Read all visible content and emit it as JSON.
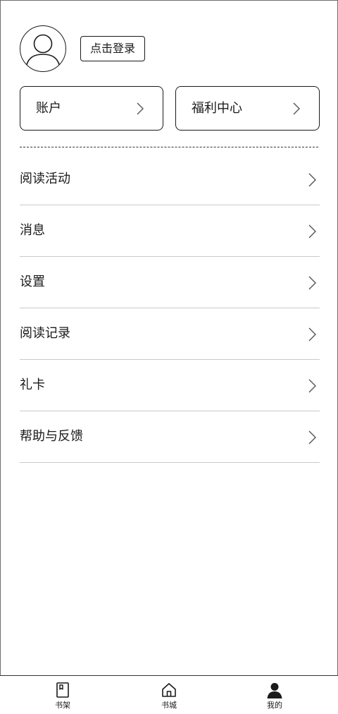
{
  "header": {
    "avatar_icon": "user-avatar-icon",
    "login_label": "点击登录"
  },
  "cards": {
    "account": {
      "label": "账户",
      "icon": "chevron-right-icon"
    },
    "welfare": {
      "label": "福利中心",
      "icon": "chevron-right-icon"
    }
  },
  "menu": {
    "items": [
      {
        "label": "阅读活动"
      },
      {
        "label": "消息"
      },
      {
        "label": "设置"
      },
      {
        "label": "阅读记录"
      },
      {
        "label": "礼卡"
      },
      {
        "label": "帮助与反馈"
      }
    ]
  },
  "tabbar": {
    "items": [
      {
        "label": "书架",
        "icon": "bookshelf-icon",
        "active": false
      },
      {
        "label": "书城",
        "icon": "home-icon",
        "active": false
      },
      {
        "label": "我的",
        "icon": "person-icon",
        "active": true
      }
    ]
  },
  "colors": {
    "text": "#1a1a1a",
    "divider": "#c9c9c9",
    "frame": "#6e6e6e",
    "background": "#ffffff"
  }
}
